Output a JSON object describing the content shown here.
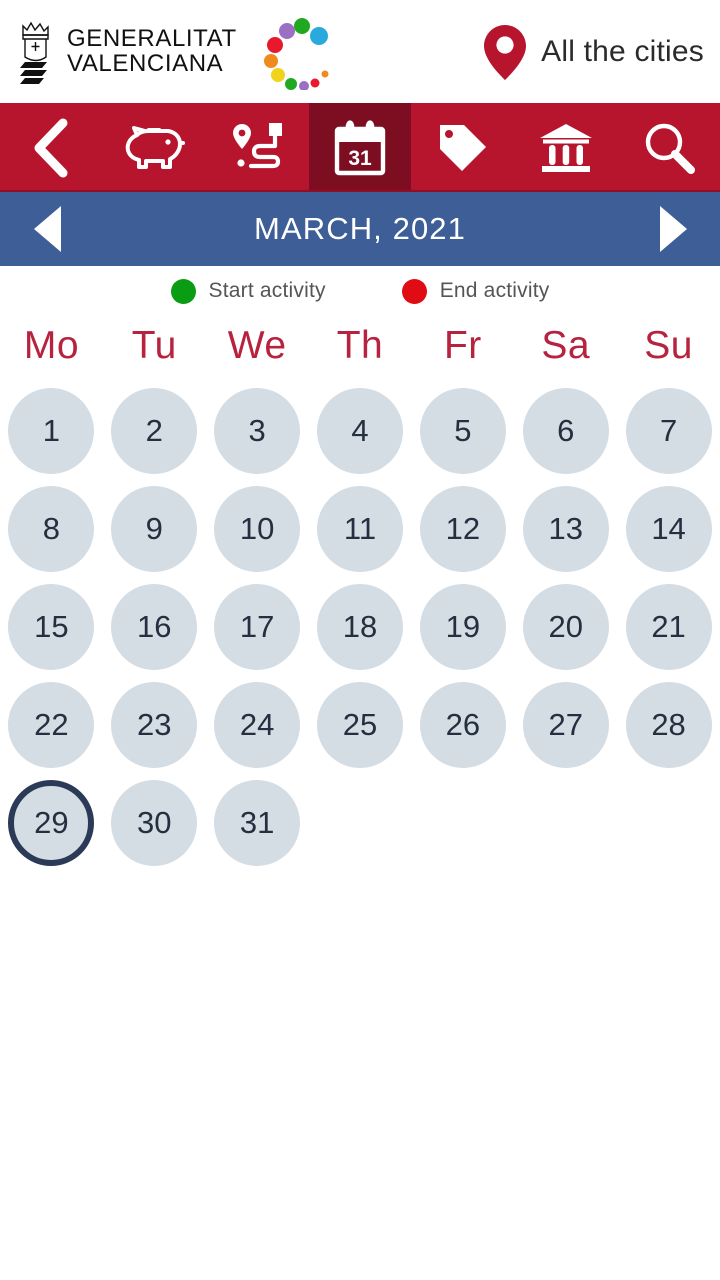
{
  "header": {
    "org_line1": "GENERALITAT",
    "org_line2": "VALENCIANA",
    "emblem_name": "generalitat-valenciana-emblem",
    "dots_logo_name": "culture-dots-logo",
    "city_selector_label": "All the cities",
    "pin_icon": "map-pin-icon",
    "pin_color": "#b7142e"
  },
  "toolbar": {
    "background": "#b7142e",
    "active_background": "#7d0e21",
    "items": [
      {
        "name": "back-button",
        "icon": "chevron-left-icon",
        "active": false
      },
      {
        "name": "tab-free",
        "icon": "piggy-bank-icon",
        "active": false
      },
      {
        "name": "tab-routes",
        "icon": "route-pin-icon",
        "active": false
      },
      {
        "name": "tab-calendar",
        "icon": "calendar-31-icon",
        "active": true
      },
      {
        "name": "tab-offers",
        "icon": "tag-icon",
        "active": false
      },
      {
        "name": "tab-museums",
        "icon": "museum-icon",
        "active": false
      },
      {
        "name": "tab-search",
        "icon": "search-icon",
        "active": false
      }
    ]
  },
  "month_bar": {
    "background": "#3d5e96",
    "title": "MARCH, 2021",
    "prev_label": "◀",
    "next_label": "▶"
  },
  "legend": [
    {
      "label": "Start activity",
      "color": "#0a9c12"
    },
    {
      "label": "End activity",
      "color": "#e00b13"
    }
  ],
  "weekdays": [
    "Mo",
    "Tu",
    "We",
    "Th",
    "Fr",
    "Sa",
    "Su"
  ],
  "calendar": {
    "month": "MARCH",
    "year": "2021",
    "today": "29",
    "day_bg": "#d4dce4",
    "day_text_color": "#24303f",
    "today_ring_color": "#2b3a56",
    "weeks": [
      [
        "1",
        "2",
        "3",
        "4",
        "5",
        "6",
        "7"
      ],
      [
        "8",
        "9",
        "10",
        "11",
        "12",
        "13",
        "14"
      ],
      [
        "15",
        "16",
        "17",
        "18",
        "19",
        "20",
        "21"
      ],
      [
        "22",
        "23",
        "24",
        "25",
        "26",
        "27",
        "28"
      ],
      [
        "29",
        "30",
        "31",
        "",
        "",
        "",
        ""
      ]
    ]
  }
}
